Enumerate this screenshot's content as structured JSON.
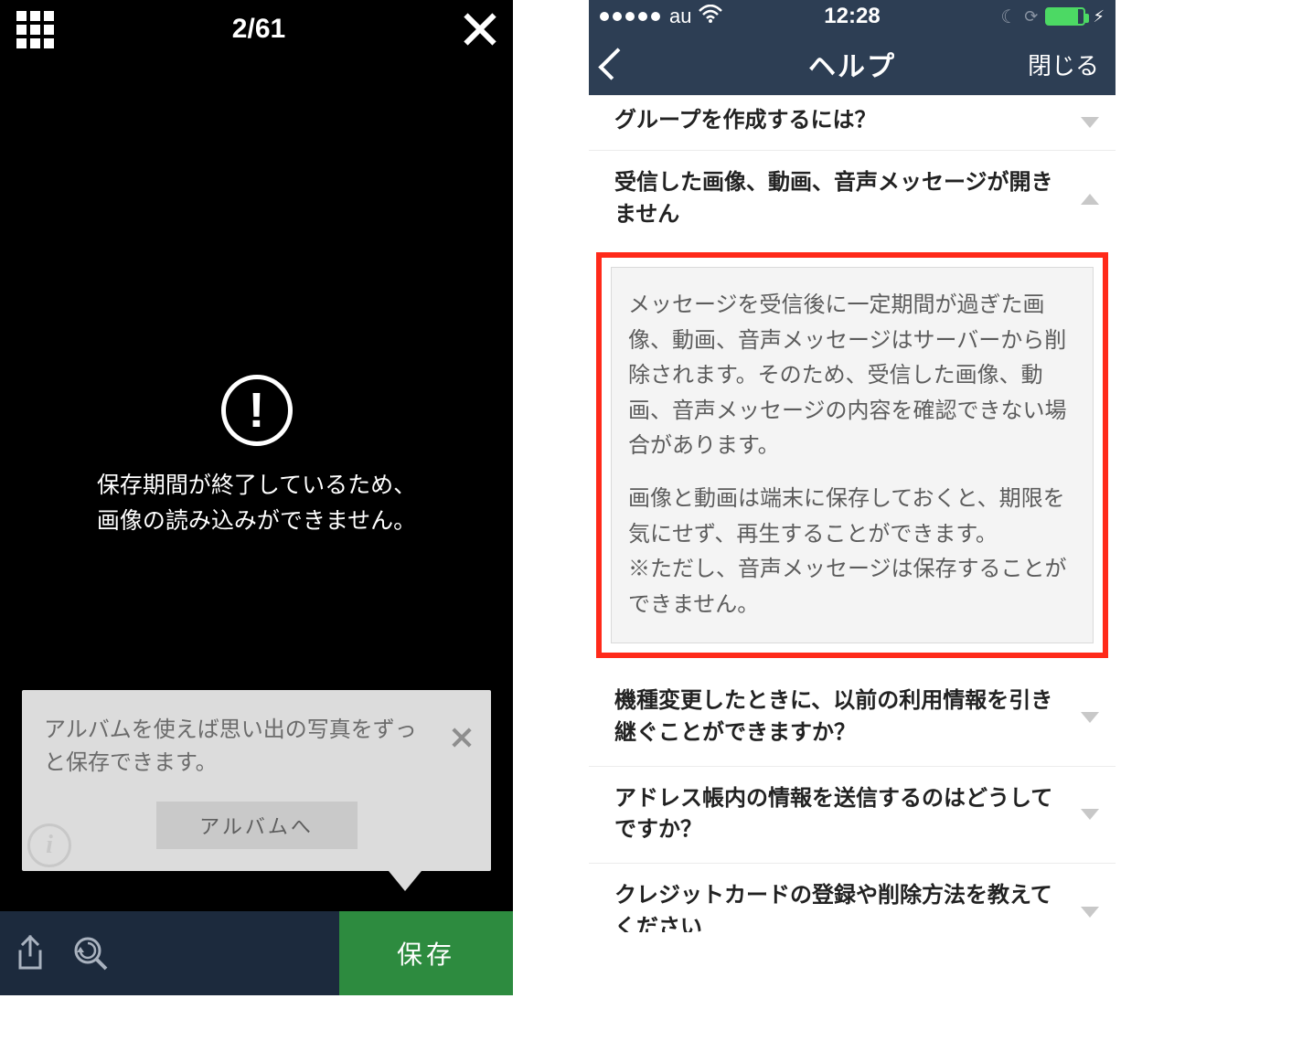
{
  "left": {
    "counter": "2/61",
    "error_line1": "保存期間が終了しているため、",
    "error_line2": "画像の読み込みができません。",
    "tooltip_text": "アルバムを使えば思い出の写真をずっと保存できます。",
    "album_button": "アルバムへ",
    "save_button": "保存"
  },
  "right": {
    "statusbar": {
      "carrier": "au",
      "time": "12:28"
    },
    "navbar": {
      "title": "ヘルプ",
      "close": "閉じる"
    },
    "items": [
      "グループを作成するには？",
      "受信した画像、動画、音声メッセージが開きません",
      "機種変更したときに、以前の利用情報を引き継ぐことができますか？",
      "アドレス帳内の情報を送信するのはどうしてですか？",
      "クレジットカードの登録や削除方法を教えてください"
    ],
    "answer_p1": "メッセージを受信後に一定期間が過ぎた画像、動画、音声メッセージはサーバーから削除されます。そのため、受信した画像、動画、音声メッセージの内容を確認できない場合があります。",
    "answer_p2": "画像と動画は端末に保存しておくと、期限を気にせず、再生することができます。",
    "answer_p3": "※ただし、音声メッセージは保存することができません。"
  }
}
